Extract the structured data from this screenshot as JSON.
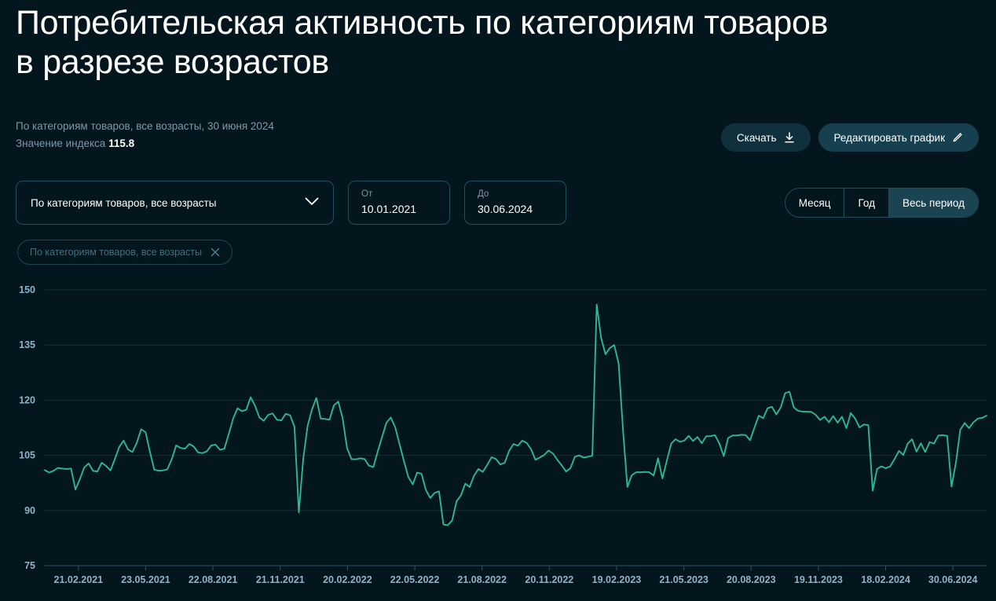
{
  "header": {
    "title": "Потребительская активность по категориям товаров\nв разрезе возрастов",
    "subtitle": "По категориям товаров, все возрасты, 30 июня 2024",
    "index_label": "Значение индекса",
    "index_value": "115.8"
  },
  "toolbar": {
    "download_label": "Скачать",
    "download_icon": "download-icon",
    "edit_label": "Редактировать график",
    "edit_icon": "pencil-icon"
  },
  "filters": {
    "category_select_value": "По категориям товаров, все возрасты",
    "chevron_icon": "chevron-down-icon",
    "date_from_label": "От",
    "date_from_value": "10.01.2021",
    "date_to_label": "До",
    "date_to_value": "30.06.2024",
    "period_options": [
      "Месяц",
      "Год",
      "Весь период"
    ],
    "period_active": "Весь период",
    "chip_label": "По категориям товаров, все возрасты",
    "chip_close_icon": "close-icon"
  },
  "colors": {
    "background": "#04161d",
    "series_line": "#2bb894",
    "grid": "#10303c",
    "accent_pill": "#16404f",
    "segment_active": "#1b4453",
    "muted_text": "#7e97a6"
  },
  "chart_data": {
    "type": "line",
    "title": "Потребительская активность по категориям товаров в разрезе возрастов",
    "xlabel": "",
    "ylabel": "",
    "grid": true,
    "legend": "none",
    "ylim": [
      75,
      150
    ],
    "yticks": [
      150,
      135,
      120,
      105,
      90,
      75
    ],
    "xticks": [
      "21.02.2021",
      "23.05.2021",
      "22.08.2021",
      "21.11.2021",
      "20.02.2022",
      "22.05.2022",
      "21.08.2022",
      "20.11.2022",
      "19.02.2023",
      "21.05.2023",
      "20.08.2023",
      "19.11.2023",
      "18.02.2024",
      "30.06.2024"
    ],
    "series": [
      {
        "name": "По категориям товаров, все возрасты",
        "color": "#2bb894",
        "values": [
          101.0,
          100.3,
          100.8,
          101.6,
          101.4,
          101.3,
          101.4,
          95.7,
          98.5,
          101.7,
          102.8,
          100.8,
          100.6,
          103.0,
          102.1,
          100.9,
          104.0,
          107.3,
          109.0,
          106.6,
          105.9,
          108.4,
          112.1,
          111.3,
          106.0,
          101.1,
          100.8,
          100.9,
          101.2,
          104.0,
          107.7,
          107.0,
          106.8,
          108.1,
          107.4,
          105.8,
          105.6,
          106.1,
          107.7,
          107.9,
          106.5,
          106.8,
          110.8,
          115.0,
          117.8,
          117.0,
          117.4,
          120.8,
          118.5,
          115.3,
          114.4,
          116.0,
          116.4,
          114.7,
          114.5,
          116.3,
          115.9,
          112.8,
          89.5,
          104.0,
          113.0,
          117.5,
          120.6,
          115.0,
          114.9,
          114.7,
          118.6,
          119.6,
          115.1,
          107.0,
          104.0,
          103.9,
          104.2,
          104.0,
          102.2,
          101.8,
          106.0,
          110.0,
          113.9,
          115.3,
          112.6,
          108.0,
          103.4,
          99.1,
          97.1,
          100.3,
          100.0,
          95.6,
          93.4,
          94.8,
          95.2,
          86.2,
          86.0,
          87.3,
          92.5,
          94.1,
          97.3,
          96.4,
          99.5,
          101.3,
          100.5,
          102.4,
          104.5,
          104.0,
          102.5,
          103.0,
          106.2,
          108.1,
          107.6,
          109.0,
          108.4,
          106.7,
          103.8,
          104.4,
          105.1,
          106.3,
          105.5,
          103.8,
          102.3,
          100.6,
          101.5,
          104.6,
          105.0,
          104.4,
          104.6,
          104.9,
          146.0,
          137.0,
          132.5,
          134.2,
          135.0,
          130.0,
          112.0,
          96.4,
          99.6,
          100.4,
          100.4,
          100.5,
          100.4,
          99.5,
          104.2,
          98.7,
          103.5,
          108.2,
          109.4,
          108.7,
          109.0,
          110.3,
          108.9,
          110.0,
          108.3,
          110.2,
          110.2,
          110.5,
          108.2,
          104.8,
          109.7,
          110.4,
          110.4,
          110.6,
          110.5,
          109.1,
          112.5,
          115.8,
          115.1,
          117.8,
          118.2,
          116.1,
          118.0,
          121.9,
          122.3,
          118.0,
          117.1,
          116.9,
          116.9,
          116.8,
          116.0,
          114.6,
          115.5,
          114.0,
          115.7,
          113.9,
          115.5,
          112.4,
          116.5,
          115.0,
          112.6,
          113.4,
          113.2,
          95.4,
          101.3,
          102.0,
          101.5,
          102.0,
          104.0,
          106.2,
          105.1,
          108.2,
          109.4,
          106.0,
          108.3,
          105.9,
          108.6,
          108.2,
          110.4,
          110.5,
          110.3,
          96.5,
          103.0,
          112.0,
          113.8,
          112.4,
          114.0,
          115.0,
          115.2,
          115.8
        ]
      }
    ]
  }
}
